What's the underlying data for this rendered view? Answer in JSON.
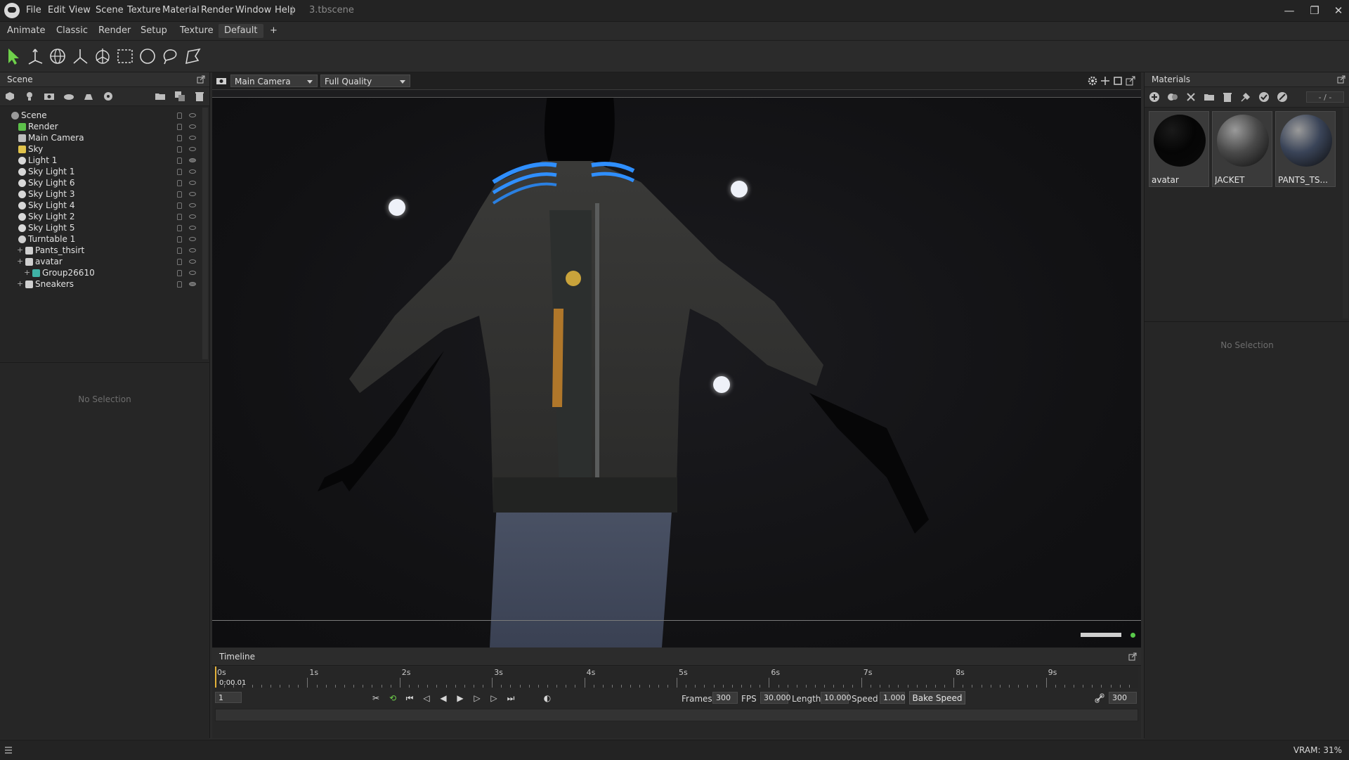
{
  "app": {
    "filename": "3.tbscene",
    "menu": [
      "File",
      "Edit",
      "View",
      "Scene",
      "Texture",
      "Material",
      "Render",
      "Window",
      "Help"
    ]
  },
  "layout_tabs": [
    "Animate",
    "Classic",
    "Render",
    "Setup",
    "Texture",
    "Default",
    "+"
  ],
  "active_layout": "Default",
  "scene": {
    "title": "Scene",
    "tree": [
      {
        "label": "Scene",
        "level": 0,
        "icon": "scene-icon",
        "visible": true
      },
      {
        "label": "Render",
        "level": 1,
        "icon": "render-icon",
        "visible": true
      },
      {
        "label": "Main Camera",
        "level": 1,
        "icon": "camera-icon",
        "visible": true
      },
      {
        "label": "Sky",
        "level": 1,
        "icon": "sky-icon",
        "visible": true
      },
      {
        "label": "Light 1",
        "level": 1,
        "icon": "light-icon",
        "visible": false
      },
      {
        "label": "Sky Light 1",
        "level": 1,
        "icon": "light-icon",
        "visible": true
      },
      {
        "label": "Sky Light 6",
        "level": 1,
        "icon": "light-icon",
        "visible": true
      },
      {
        "label": "Sky Light 3",
        "level": 1,
        "icon": "light-icon",
        "visible": true
      },
      {
        "label": "Sky Light 4",
        "level": 1,
        "icon": "light-icon",
        "visible": true
      },
      {
        "label": "Sky Light 2",
        "level": 1,
        "icon": "light-icon",
        "visible": true
      },
      {
        "label": "Sky Light 5",
        "level": 1,
        "icon": "light-icon",
        "visible": true
      },
      {
        "label": "Turntable 1",
        "level": 1,
        "icon": "turntable-icon",
        "visible": true
      },
      {
        "label": "Pants_thsirt",
        "level": 2,
        "icon": "mesh-icon",
        "visible": true
      },
      {
        "label": "avatar",
        "level": 2,
        "icon": "mesh-icon",
        "visible": true
      },
      {
        "label": "Group26610",
        "level": 3,
        "icon": "group-icon",
        "visible": true
      },
      {
        "label": "Sneakers",
        "level": 2,
        "icon": "mesh-icon",
        "visible": false
      }
    ],
    "props_empty": "No Selection"
  },
  "viewport": {
    "camera": "Main Camera",
    "quality": "Full Quality"
  },
  "materials": {
    "title": "Materials",
    "page": "- / -",
    "items": [
      {
        "name": "avatar",
        "color": "#050505"
      },
      {
        "name": "JACKET",
        "color": "#4a4a4a"
      },
      {
        "name": "PANTS_TS...",
        "color": "#3a4458"
      }
    ],
    "props_empty": "No Selection"
  },
  "timeline": {
    "title": "Timeline",
    "ticks": [
      "0s",
      "1s",
      "2s",
      "3s",
      "4s",
      "5s",
      "6s",
      "7s",
      "8s",
      "9s"
    ],
    "timecode": "0:00.01",
    "frame": "1",
    "frames_label": "Frames",
    "frames": "300",
    "fps_label": "FPS",
    "fps": "30.000",
    "length_label": "Length",
    "length": "10.000",
    "speed_label": "Speed",
    "speed": "1.000",
    "bake_label": "Bake Speed",
    "end_frame": "300"
  },
  "status": {
    "vram": "VRAM: 31%"
  }
}
